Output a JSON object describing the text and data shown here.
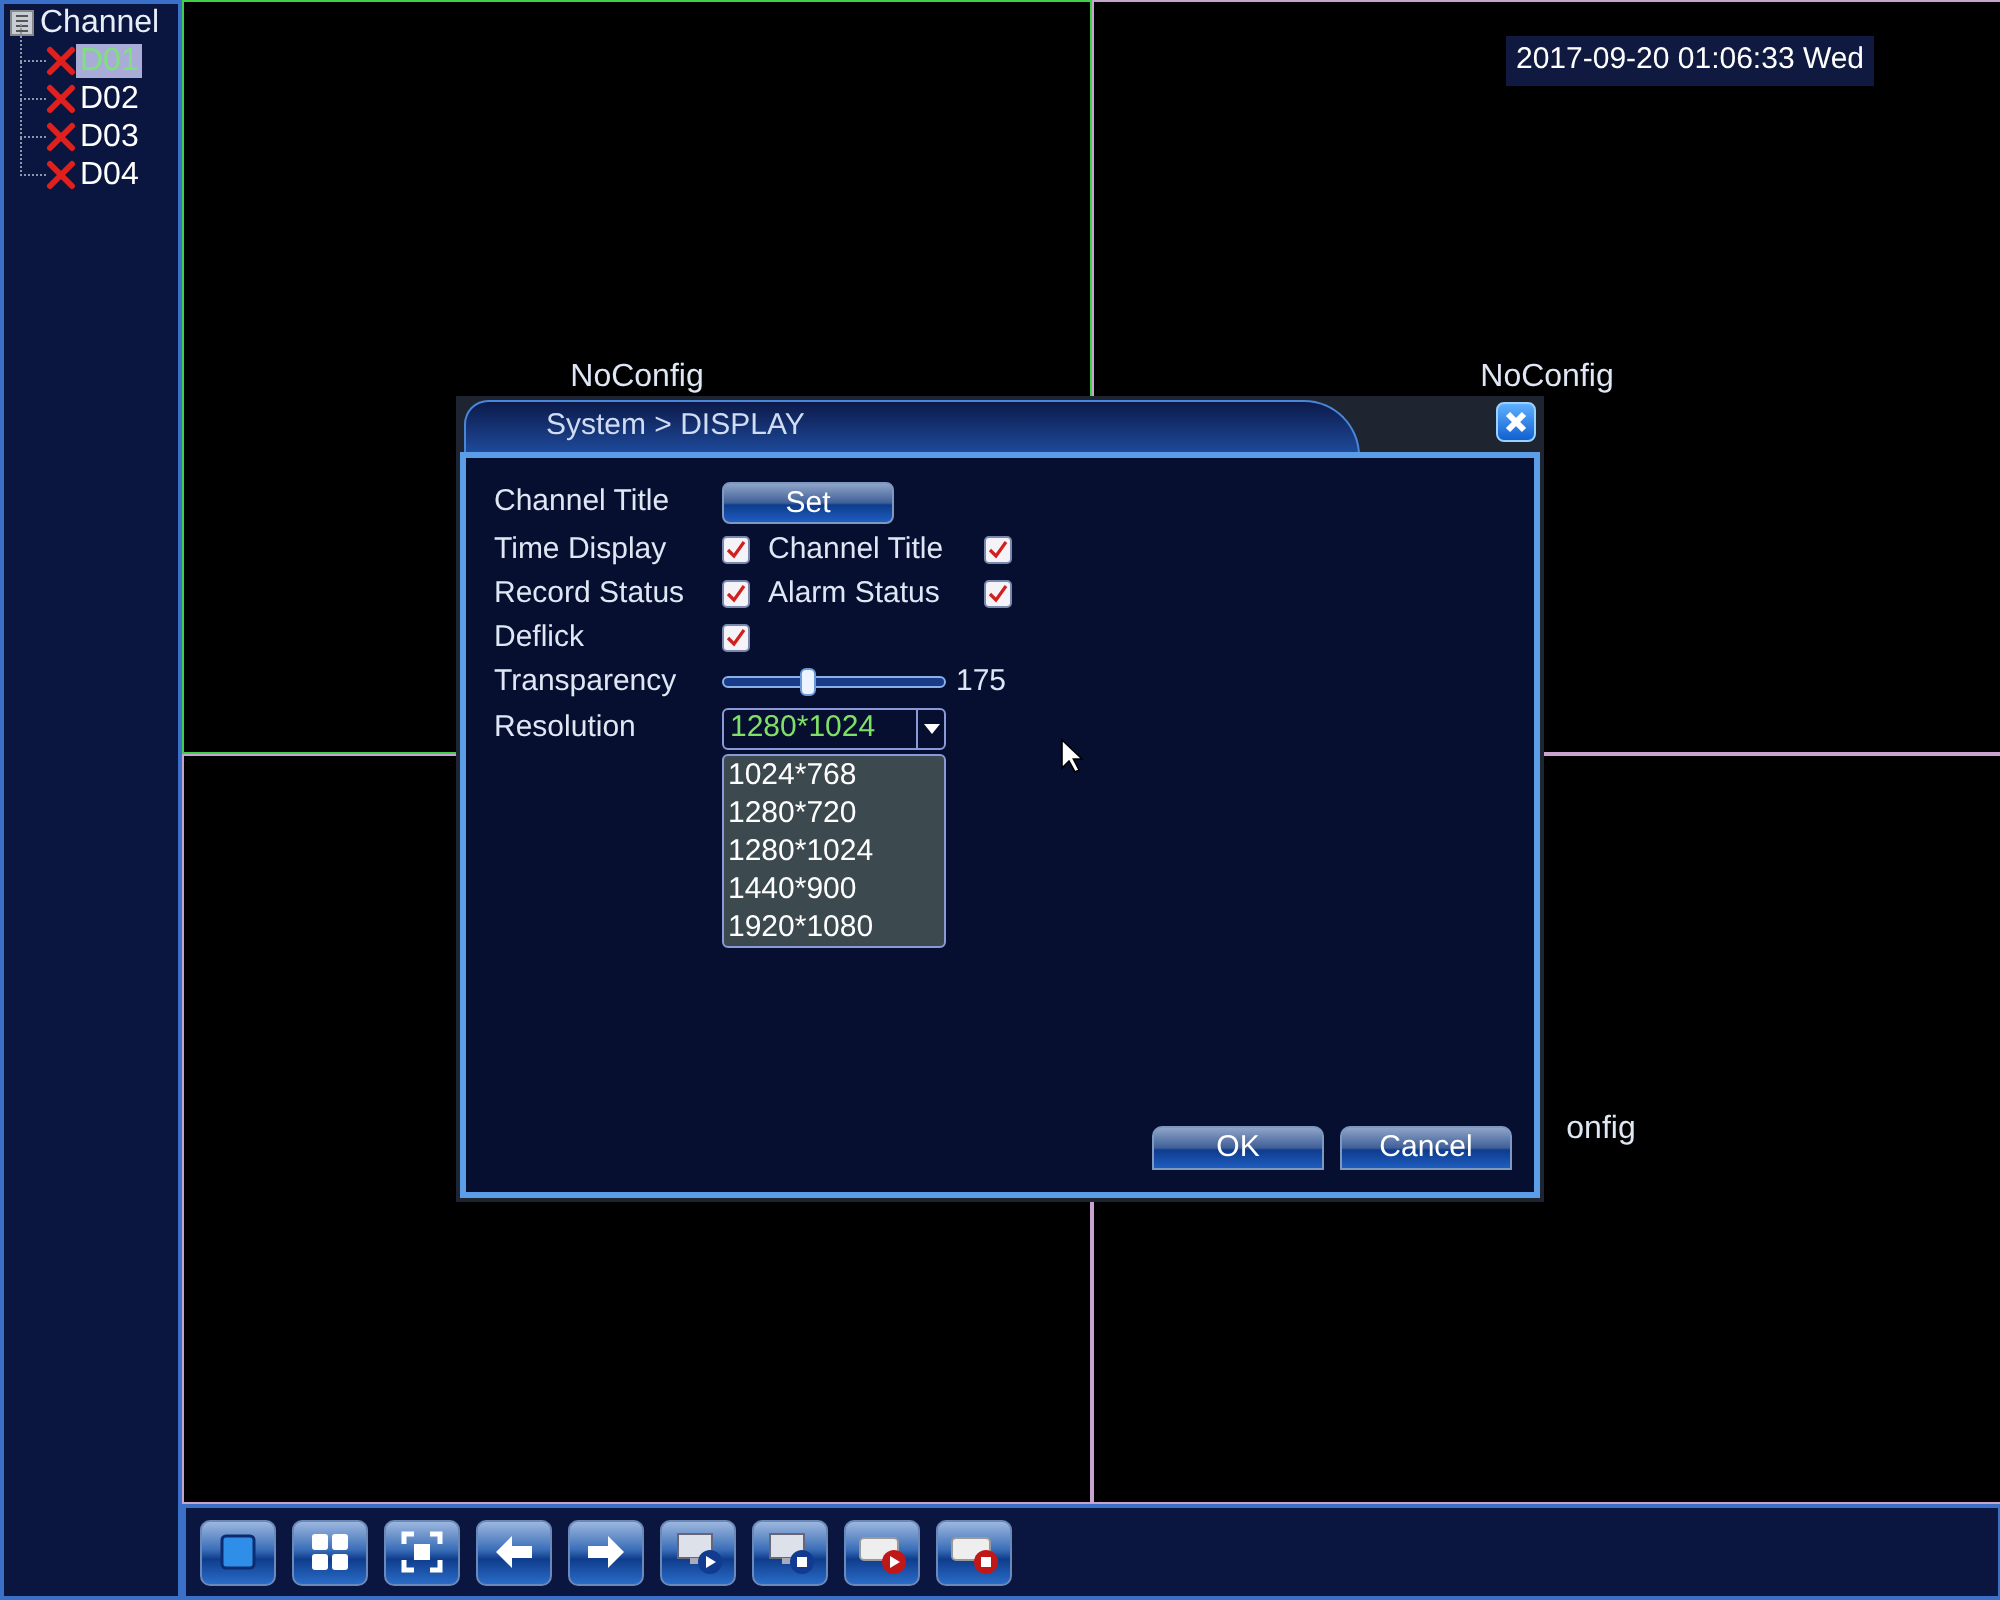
{
  "sidebar": {
    "title": "Channel",
    "items": [
      {
        "label": "D01",
        "selected": true
      },
      {
        "label": "D02",
        "selected": false
      },
      {
        "label": "D03",
        "selected": false
      },
      {
        "label": "D04",
        "selected": false
      }
    ]
  },
  "clock": "2017-09-20 01:06:33 Wed",
  "cells": [
    {
      "label": "NoConfig",
      "selected": true
    },
    {
      "label": "NoConfig",
      "selected": false
    },
    {
      "selected": false
    },
    {
      "label": "onfig",
      "selected": false
    }
  ],
  "dialog": {
    "title": "System > DISPLAY",
    "rows": [
      {
        "kind": "button",
        "label": "Channel Title",
        "button": "Set"
      },
      {
        "kind": "checks",
        "items": [
          {
            "label": "Time Display",
            "checked": true
          },
          {
            "label": "Channel Title",
            "checked": true
          }
        ]
      },
      {
        "kind": "checks",
        "items": [
          {
            "label": "Record Status",
            "checked": true
          },
          {
            "label": "Alarm Status",
            "checked": true
          }
        ]
      },
      {
        "kind": "checks",
        "items": [
          {
            "label": "Deflick",
            "checked": true
          }
        ]
      },
      {
        "kind": "slider",
        "label": "Transparency",
        "level": 0.37,
        "reading": "175"
      },
      {
        "kind": "select",
        "label": "Resolution",
        "value": "1280*1024",
        "expanded": true,
        "options": [
          "1024*768",
          "1280*720",
          "1280*1024",
          "1440*900",
          "1920*1080"
        ]
      }
    ],
    "buttons": [
      "OK",
      "Cancel"
    ]
  },
  "toolbar": [
    {
      "kind": "single"
    },
    {
      "kind": "quad"
    },
    {
      "kind": "fullscreen"
    },
    {
      "kind": "back"
    },
    {
      "kind": "forward"
    },
    {
      "kind": "monitor-play"
    },
    {
      "kind": "monitor-stop"
    },
    {
      "kind": "record-play"
    },
    {
      "kind": "record-stop"
    }
  ]
}
